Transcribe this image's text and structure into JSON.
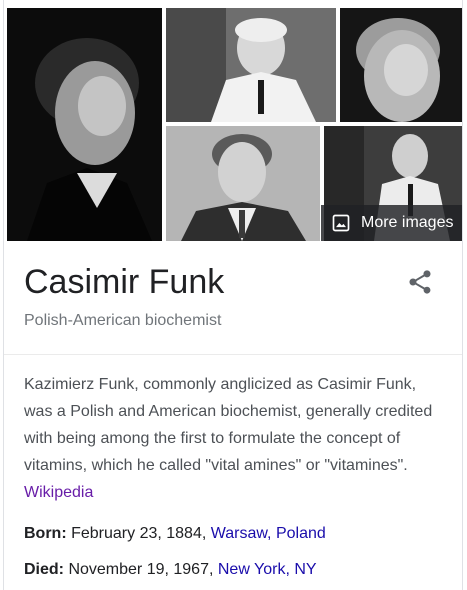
{
  "more_images": {
    "label": "More images",
    "icon": "image-icon"
  },
  "header": {
    "name": "Casimir Funk",
    "subtitle": "Polish-American biochemist",
    "share_icon": "share-icon"
  },
  "description": {
    "text": "Kazimierz Funk, commonly anglicized as Casimir Funk, was a Polish and American biochemist, generally credited with being among the first to formulate the concept of vitamins, which he called \"vital amines\" or \"vitamines\". ",
    "source_link": "Wikipedia"
  },
  "facts": {
    "born": {
      "label": "Born:",
      "value": " February 23, 1884, ",
      "link": "Warsaw, Poland"
    },
    "died": {
      "label": "Died:",
      "value": " November 19, 1967, ",
      "link": "New York, NY"
    }
  },
  "colors": {
    "link": "#1a0dab",
    "visited_link": "#681da8",
    "subtitle": "#70757a"
  }
}
